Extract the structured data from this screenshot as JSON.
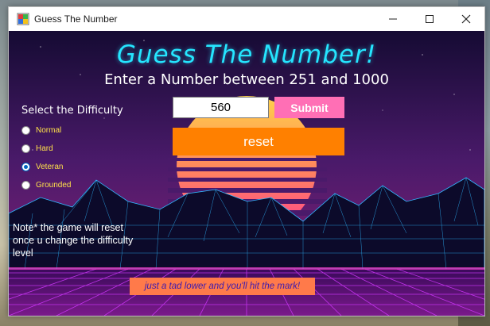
{
  "window": {
    "title": "Guess The Number",
    "minimize_icon": "minimize-icon",
    "maximize_icon": "maximize-icon",
    "close_icon": "close-icon"
  },
  "game": {
    "title": "Guess The Number!",
    "instruction": "Enter a Number between 251 and 1000",
    "difficulty_label": "Select the Difficulty",
    "difficulties": [
      {
        "label": "Normal",
        "checked": false
      },
      {
        "label": "Hard",
        "checked": false
      },
      {
        "label": "Veteran",
        "checked": true
      },
      {
        "label": "Grounded",
        "checked": false
      }
    ],
    "input_value": "560",
    "submit_label": "Submit",
    "reset_label": "reset",
    "note": "Note* the game will reset once u change the difficulty level",
    "hint": "just a tad lower and you'll hit the mark!"
  },
  "colors": {
    "title_cyan": "#25e6ff",
    "submit_pink": "#ff6fb5",
    "reset_orange": "#ff8000",
    "radio_label_yellow": "#ffe14a",
    "hint_bg": "#ff7a4a",
    "hint_text": "#3b1ab0"
  }
}
